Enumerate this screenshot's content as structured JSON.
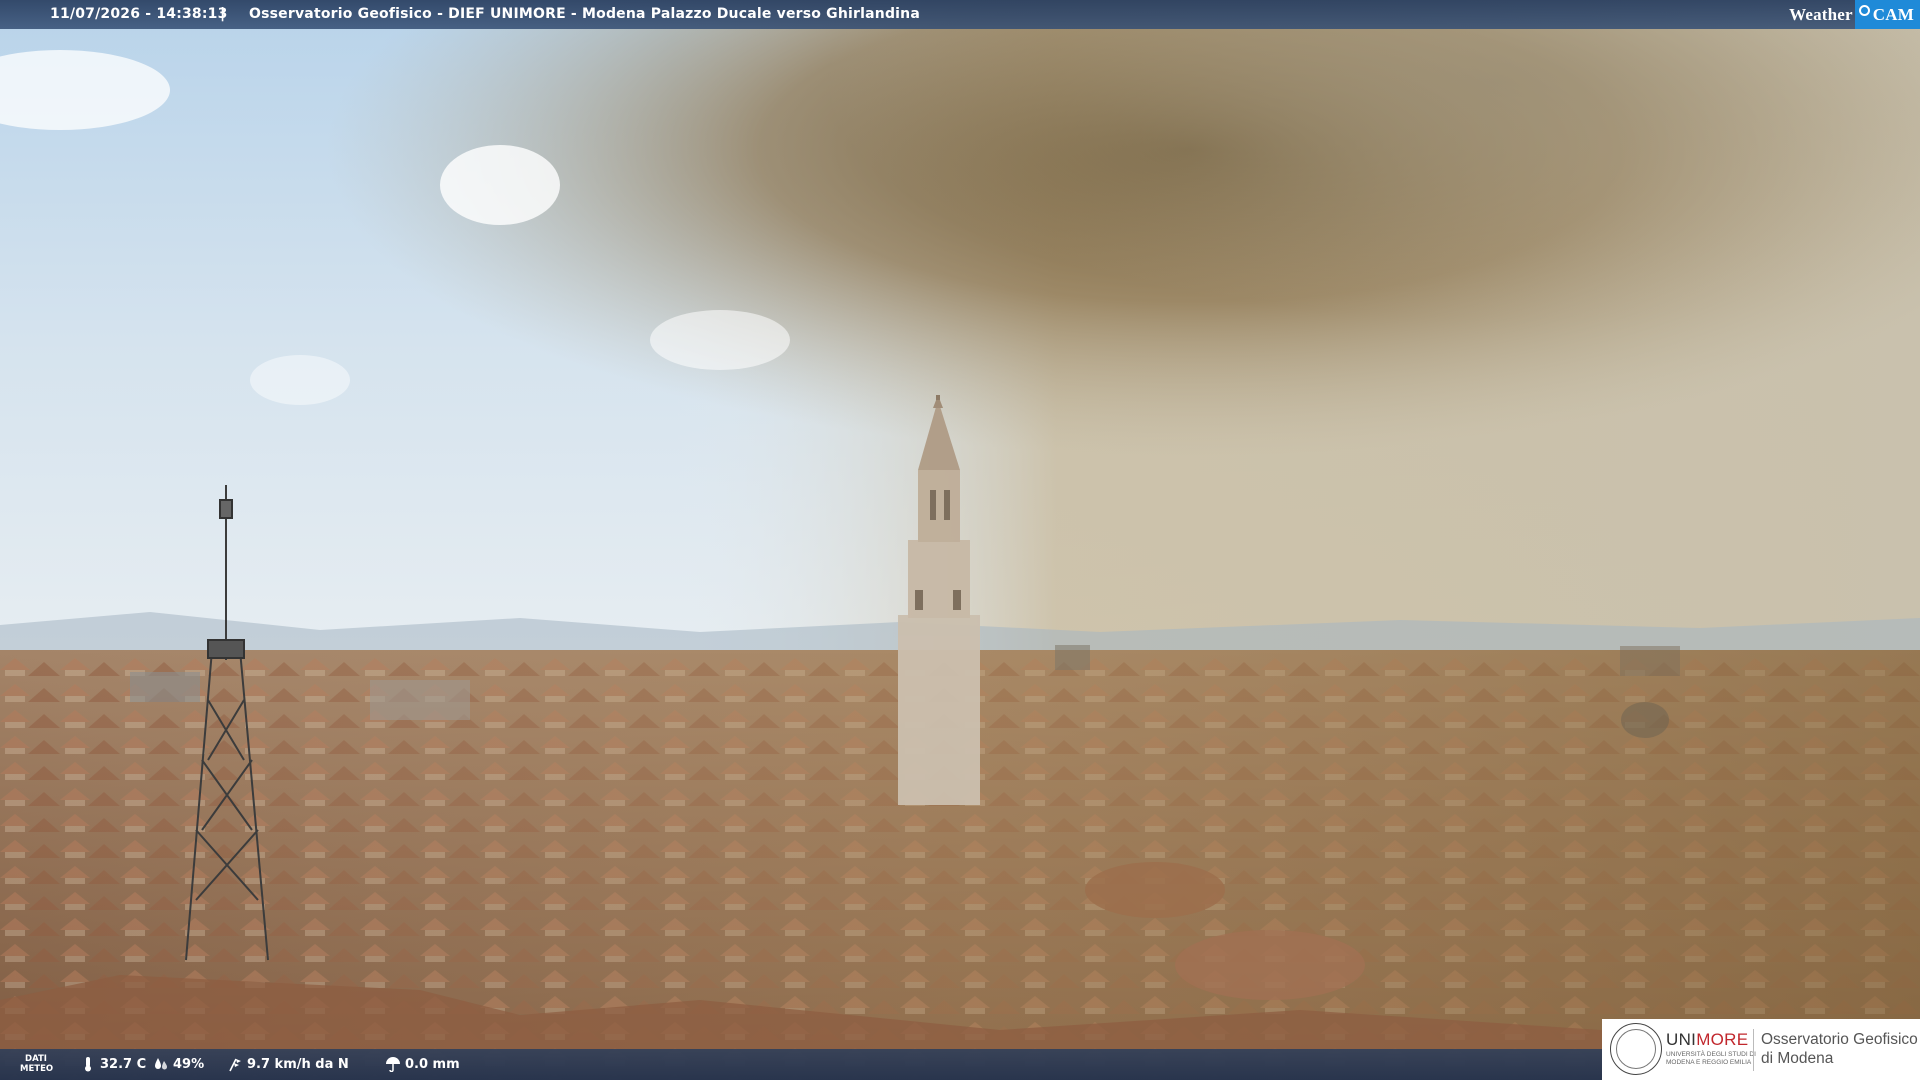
{
  "header": {
    "datetime": "11/07/2026 - 14:38:13",
    "separator": "|",
    "caption": "Osservatorio Geofisico - DIEF UNIMORE - Modena Palazzo Ducale verso Ghirlandina"
  },
  "brand": {
    "weather": "Weather",
    "cam": "CAM"
  },
  "meteo": {
    "label_line1": "DATI",
    "label_line2": "METEO",
    "temperature": "32.7 C",
    "humidity": "49%",
    "wind": "9.7 km/h da N",
    "rain": "0.0 mm",
    "icons": [
      "thermometer-icon",
      "humidity-icon",
      "wind-icon",
      "rain-gauge-icon"
    ]
  },
  "logo": {
    "uni_prefix": "UNI",
    "uni_suffix": "MORE",
    "uni_subtitle": "UNIVERSITÀ DEGLI STUDI DI MODENA E REGGIO EMILIA",
    "observatory_line1": "Osservatorio Geofisico",
    "observatory_line2": "di Modena"
  },
  "colors": {
    "bar": "#2e4b76",
    "cam_accent": "#1f8ad8",
    "unimore_red": "#c1272d"
  }
}
